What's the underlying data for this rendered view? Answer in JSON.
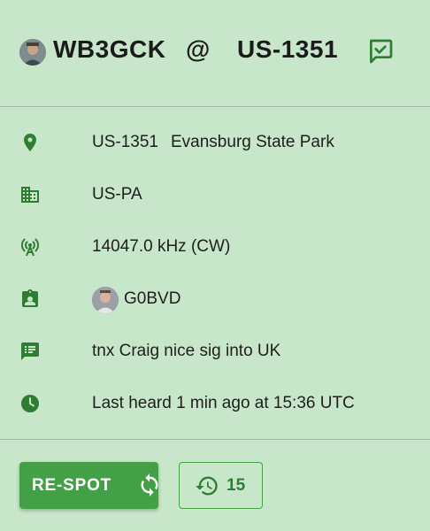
{
  "header": {
    "activator_callsign": "WB3GCK",
    "at_symbol": "@",
    "park_ref": "US-1351"
  },
  "details": [
    {
      "icon": "location-pin-icon",
      "text": "US-1351",
      "text2": "Evansburg State Park"
    },
    {
      "icon": "buildings-icon",
      "text": "US-PA"
    },
    {
      "icon": "antenna-icon",
      "text": "14047.0 kHz (CW)"
    },
    {
      "icon": "contact-badge-icon",
      "text": "G0BVD"
    },
    {
      "icon": "comment-icon",
      "text": "tnx Craig nice sig into UK"
    },
    {
      "icon": "clock-icon",
      "text": "Last heard 1 min ago at 15:36 UTC"
    }
  ],
  "actions": {
    "respot_label": "RE-SPOT",
    "history_count": "15"
  },
  "colors": {
    "background": "#c8e6c9",
    "accent": "#43a047",
    "icon": "#2e7d32"
  }
}
